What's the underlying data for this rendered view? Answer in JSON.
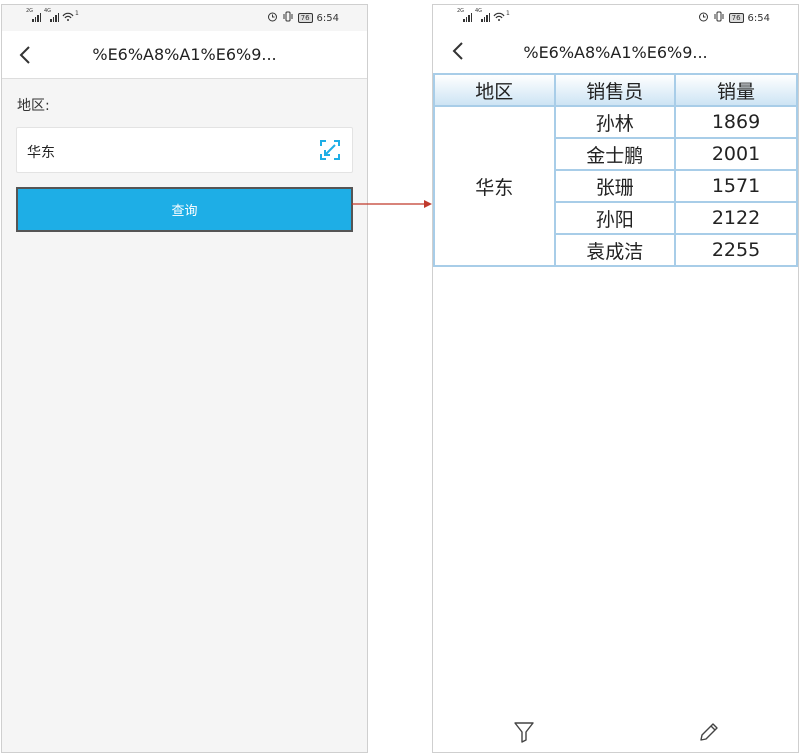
{
  "left_screen": {
    "status_bar": {
      "sig1_label": "2G",
      "sig2_label": "4G",
      "wifi_label": "1",
      "battery": "76",
      "time": "6:54"
    },
    "nav": {
      "title": "%E6%A8%A1%E6%9..."
    },
    "form": {
      "region_label": "地区:",
      "region_value": "华东",
      "query_button": "查询"
    }
  },
  "right_screen": {
    "status_bar": {
      "sig1_label": "2G",
      "sig2_label": "4G",
      "wifi_label": "1",
      "battery": "76",
      "time": "6:54"
    },
    "nav": {
      "title": "%E6%A8%A1%E6%9..."
    },
    "table": {
      "headers": [
        "地区",
        "销售员",
        "销量"
      ],
      "region": "华东",
      "rows": [
        {
          "salesperson": "孙林",
          "sales": "1869"
        },
        {
          "salesperson": "金士鹏",
          "sales": "2001"
        },
        {
          "salesperson": "张珊",
          "sales": "1571"
        },
        {
          "salesperson": "孙阳",
          "sales": "2122"
        },
        {
          "salesperson": "袁成洁",
          "sales": "2255"
        }
      ]
    }
  },
  "colors": {
    "accent": "#1eaee6",
    "table_border": "#a8cde8",
    "arrow": "#c0392b"
  }
}
